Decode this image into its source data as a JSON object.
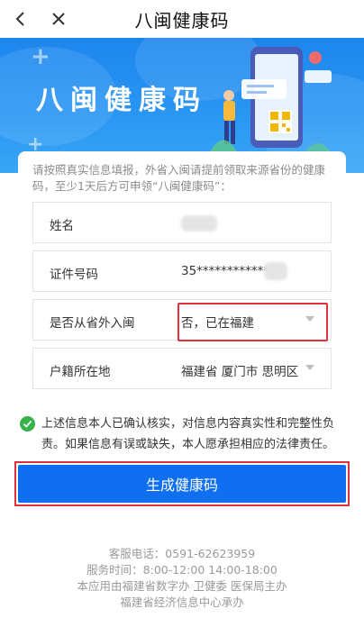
{
  "nav": {
    "title": "八闽健康码"
  },
  "banner": {
    "title": "八闽健康码"
  },
  "intro": "请按照真实信息填报，外省入闽请提前领取来源省份的健康码，至少1天后方可申领“八闽健康码”：",
  "fields": [
    {
      "label": "姓名",
      "value": ""
    },
    {
      "label": "证件号码",
      "value": "35*************"
    },
    {
      "label": "是否从省外入闽",
      "value": "否，已在福建"
    },
    {
      "label": "户籍所在地",
      "value": "福建省 厦门市 思明区"
    }
  ],
  "consent": "上述信息本人已确认核实，对信息内容真实性和完整性负责。如果信息有误或缺失，本人愿承担相应的法律责任。",
  "button": {
    "label": "生成健康码"
  },
  "footer": {
    "line1": "客服电话：0591-62623959",
    "line2": "服务时间：8:00-12:00 14:00-18:00",
    "line3": "本应用由福建省数字办 卫健委 医保局主办",
    "line4": "福建省经济信息中心承办"
  },
  "colors": {
    "primary": "#0f6ff0",
    "banner": "#1d86ee",
    "highlight": "#e0323c",
    "check": "#35b34a"
  }
}
